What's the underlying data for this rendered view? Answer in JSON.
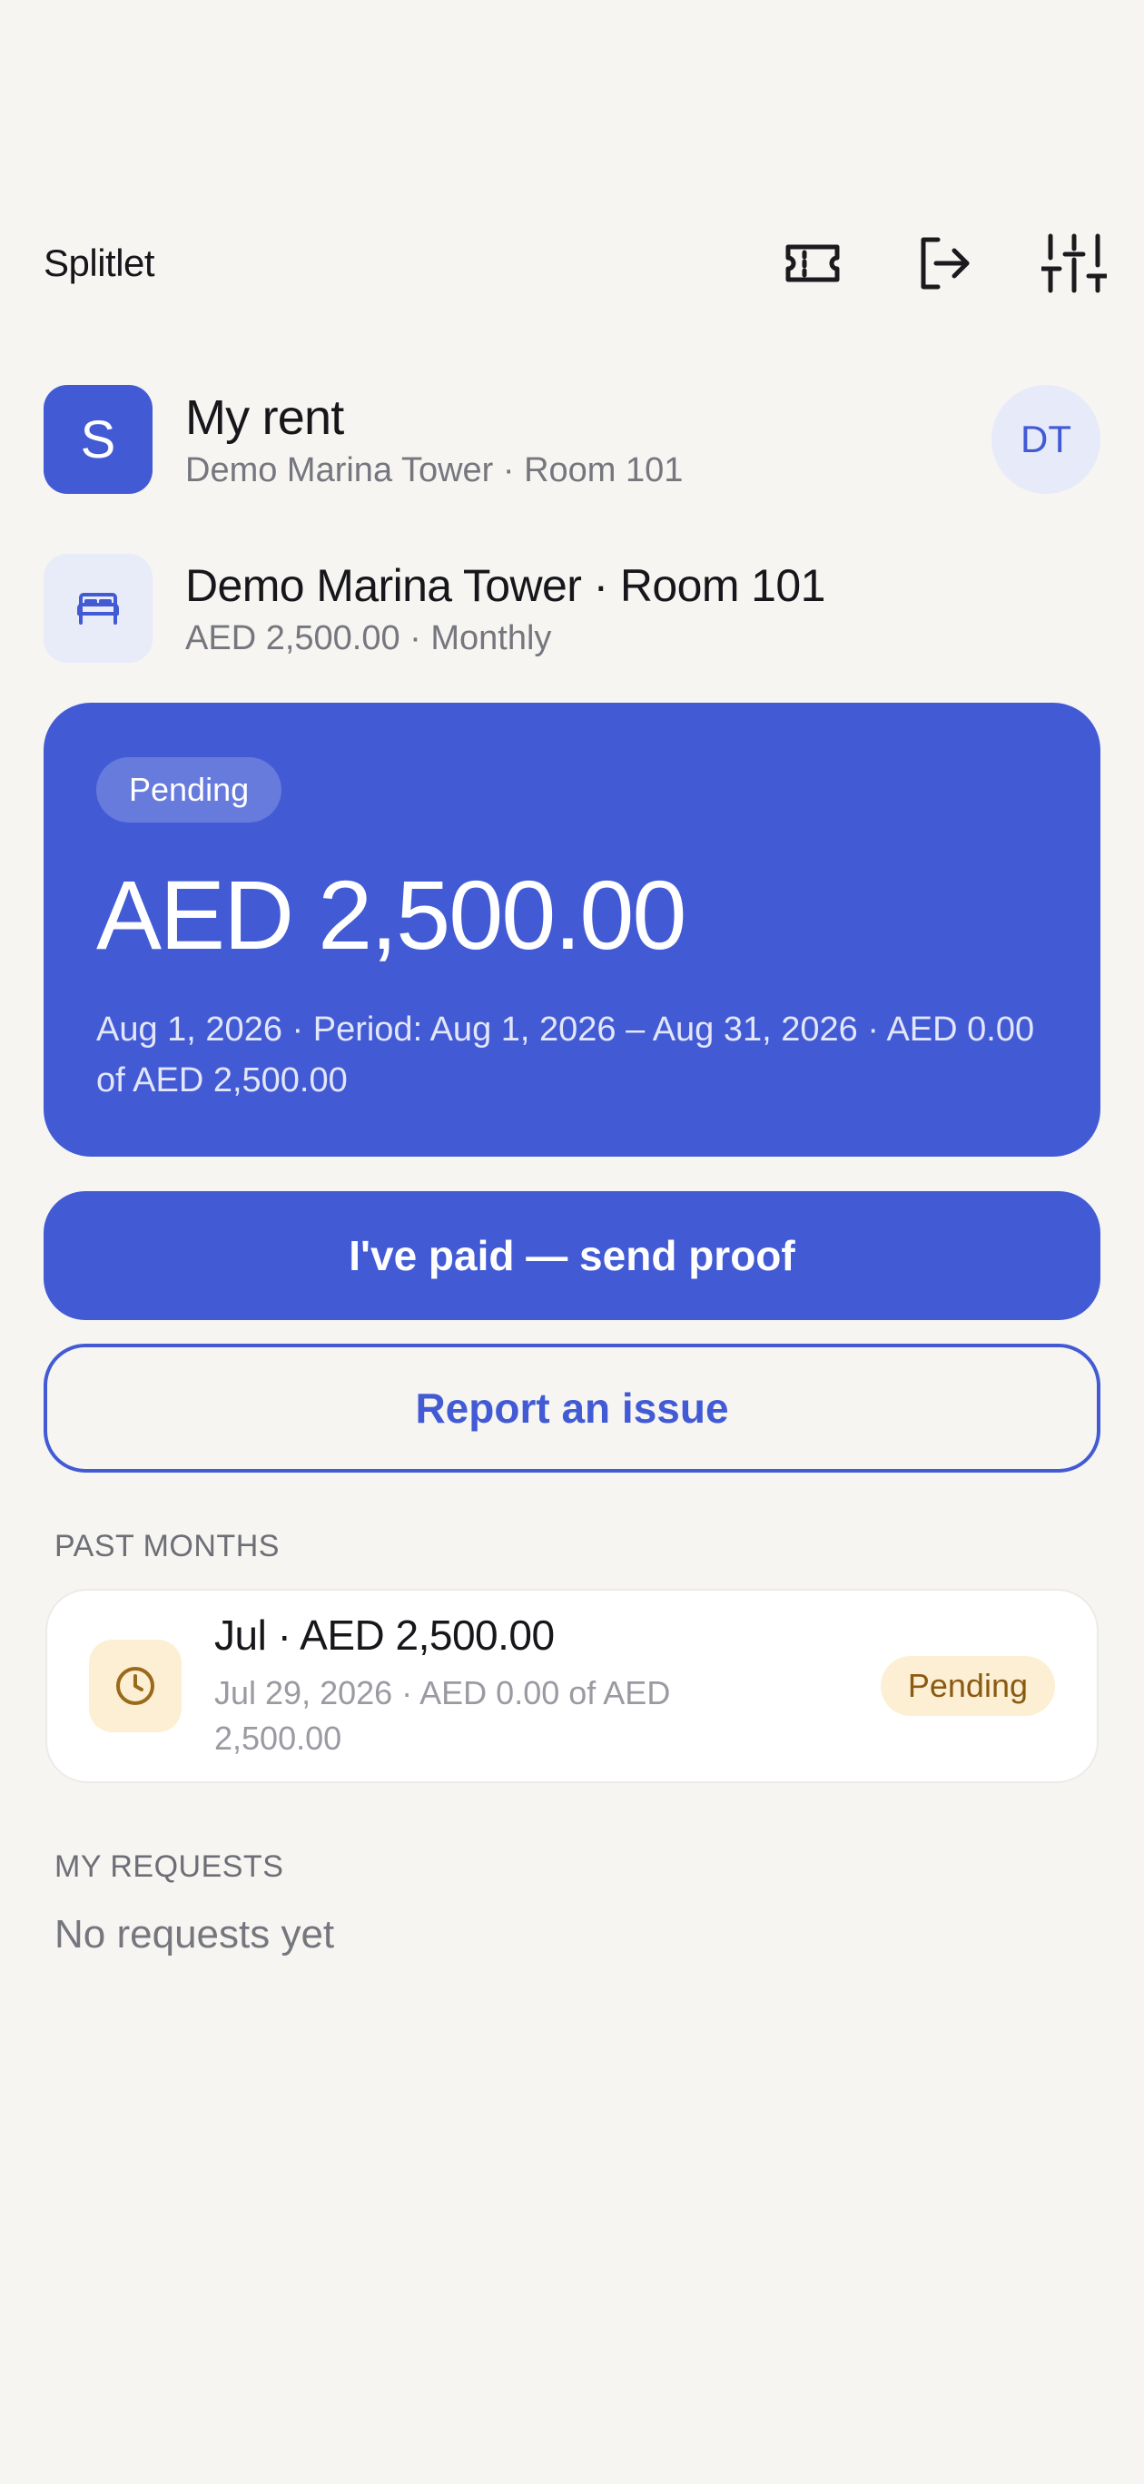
{
  "app": {
    "title": "Splitlet"
  },
  "toolbar": {
    "icons": [
      "ticket-icon",
      "logout-icon",
      "sliders-icon"
    ]
  },
  "header": {
    "avatar_letter": "S",
    "title": "My rent",
    "subtitle": "Demo Marina Tower · Room 101",
    "user_initials": "DT"
  },
  "property": {
    "icon": "bed-icon",
    "title": "Demo Marina Tower · Room 101",
    "subtitle": "AED 2,500.00 · Monthly"
  },
  "current": {
    "status": "Pending",
    "amount": "AED 2,500.00",
    "detail": "Aug 1, 2026 · Period: Aug 1, 2026 – Aug 31, 2026 · AED 0.00 of AED 2,500.00"
  },
  "actions": {
    "paid_label": "I've paid — send proof",
    "report_label": "Report an issue"
  },
  "past_months": {
    "heading": "PAST MONTHS",
    "items": [
      {
        "icon": "clock-icon",
        "title": "Jul · AED 2,500.00",
        "subtitle": "Jul 29, 2026 · AED 0.00 of AED 2,500.00",
        "status": "Pending"
      }
    ]
  },
  "requests": {
    "heading": "MY REQUESTS",
    "empty_text": "No requests yet"
  },
  "colors": {
    "accent": "#425bd5",
    "background": "#f6f5f2",
    "pending_bg": "#fcefd3",
    "pending_text": "#8a5a12"
  }
}
